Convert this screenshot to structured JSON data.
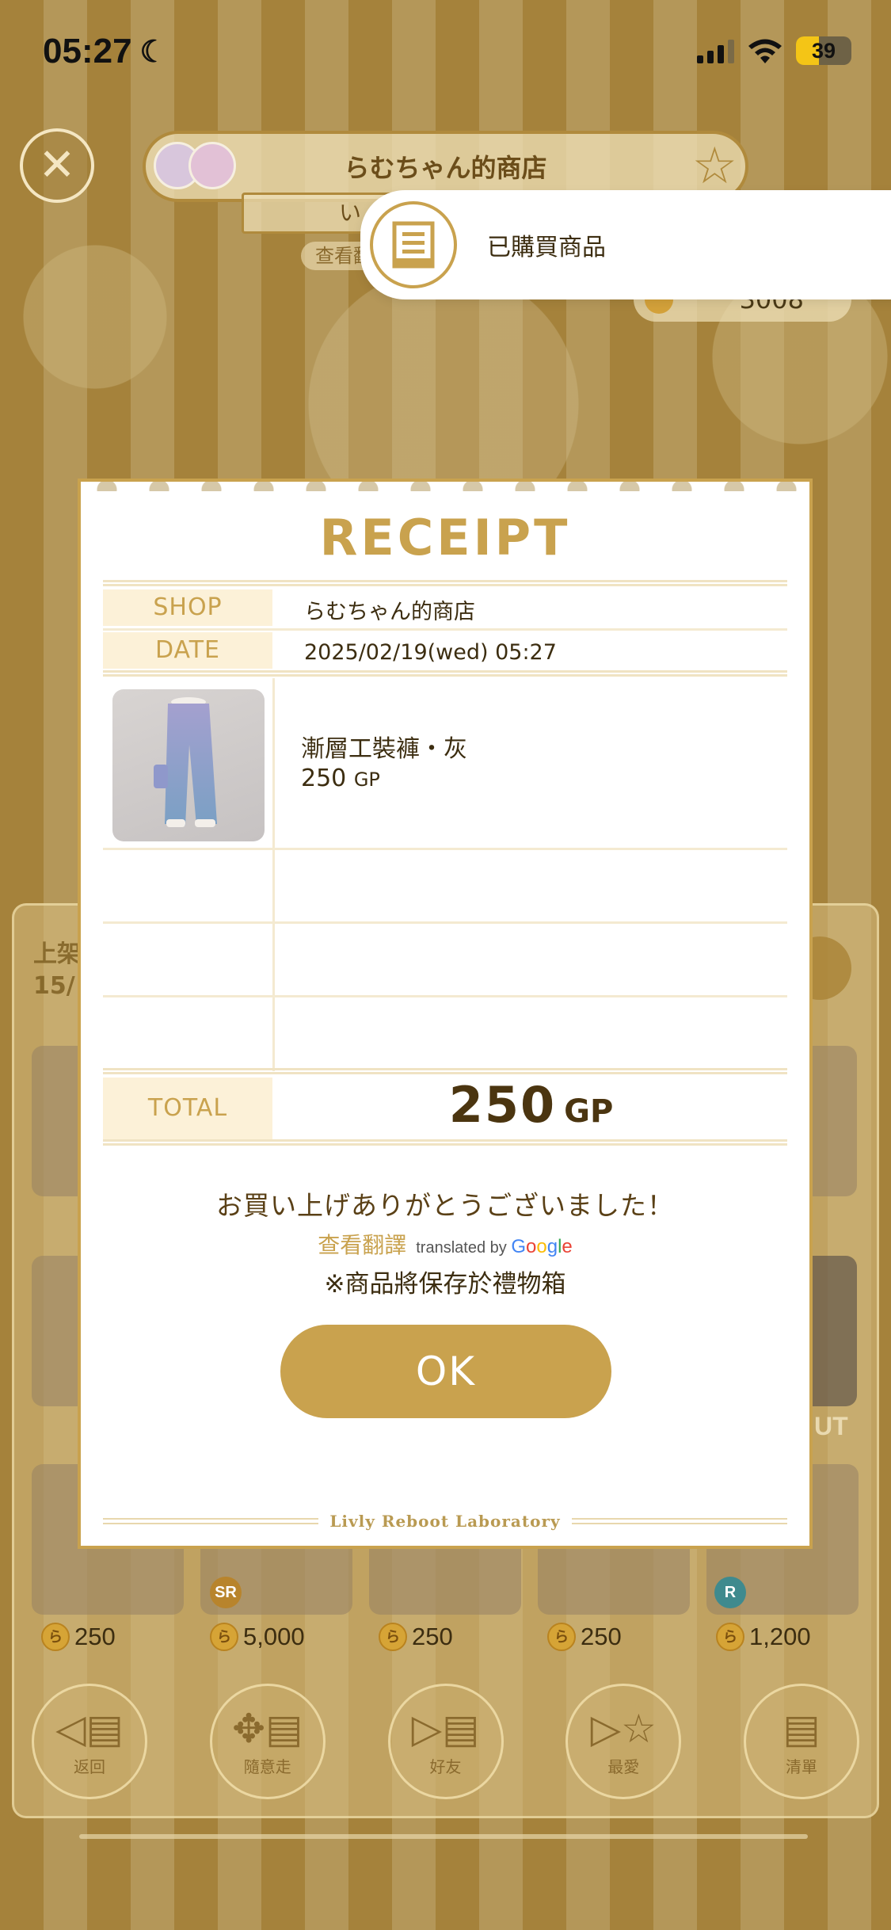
{
  "status_bar": {
    "time": "05:27",
    "battery": "39"
  },
  "background_app": {
    "shop_name": "らむちゃん的商店",
    "subtab_label": "い",
    "pill_label": "查看翻",
    "coins": "3008",
    "panel_title_line1": "上架",
    "panel_title_line2": "15/",
    "sold_out_fragment": "UT",
    "prices": [
      "250",
      "5,000",
      "250",
      "250",
      "1,200"
    ],
    "rarity_badges": [
      "SR",
      "R"
    ],
    "nav": [
      {
        "label": "返回",
        "icon": "back-icon"
      },
      {
        "label": "隨意走",
        "icon": "random-walk-icon"
      },
      {
        "label": "好友",
        "icon": "friends-icon"
      },
      {
        "label": "最愛",
        "icon": "favorites-icon"
      },
      {
        "label": "清單",
        "icon": "list-icon"
      }
    ]
  },
  "toast": {
    "icon": "receipt-icon",
    "message": "已購買商品"
  },
  "receipt": {
    "title": "RECEIPT",
    "shop_label": "SHOP",
    "shop_value": "らむちゃん的商店",
    "date_label": "DATE",
    "date_value": "2025/02/19(wed) 05:27",
    "item": {
      "name": "漸層工裝褲・灰",
      "price": "250",
      "unit": "GP"
    },
    "total_label": "TOTAL",
    "total_value": "250",
    "total_unit": "GP",
    "thanks": "お買い上げありがとうございました！",
    "translate_link": "查看翻譯",
    "translated_by": "translated by",
    "google": "Google",
    "note": "※商品將保存於禮物箱",
    "ok_label": "OK",
    "footer_brand": "Livly Reboot Laboratory"
  },
  "colors": {
    "accent_gold": "#c9a24e",
    "label_bg": "#fcf1d8",
    "text_dark": "#3c2d10",
    "google_blue": "#4285F4",
    "google_red": "#EA4335",
    "google_yellow": "#FBBC05",
    "google_green": "#34A853"
  }
}
